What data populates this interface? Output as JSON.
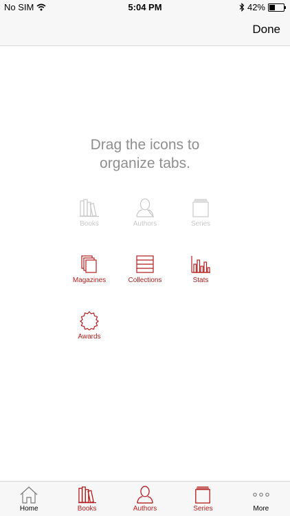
{
  "status_bar": {
    "carrier": "No SIM",
    "time": "5:04 PM",
    "battery": "42%",
    "battery_level": 0.42
  },
  "nav": {
    "done_label": "Done"
  },
  "instructions": {
    "line1": "Drag the icons to",
    "line2": "organize tabs."
  },
  "grid": {
    "books": "Books",
    "authors": "Authors",
    "series": "Series",
    "magazines": "Magazines",
    "collections": "Collections",
    "stats": "Stats",
    "awards": "Awards"
  },
  "tab_bar": {
    "home": "Home",
    "books": "Books",
    "authors": "Authors",
    "series": "Series",
    "more": "More"
  },
  "colors": {
    "accent": "#b31b1b",
    "disabled": "#c7c7c7",
    "instruction": "#8e8e8e"
  }
}
